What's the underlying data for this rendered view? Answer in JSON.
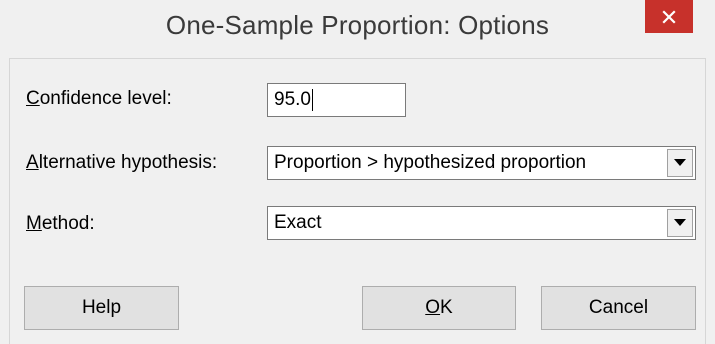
{
  "window": {
    "title": "One-Sample Proportion: Options",
    "close_symbol": "✕"
  },
  "fields": {
    "confidence_level": {
      "label_mnemonic": "C",
      "label_rest": "onfidence level:",
      "value": "95.0"
    },
    "alternative_hypothesis": {
      "label_mnemonic": "A",
      "label_rest": "lternative hypothesis:",
      "selected": "Proportion > hypothesized proportion"
    },
    "method": {
      "label_mnemonic": "M",
      "label_rest": "ethod:",
      "selected": "Exact"
    }
  },
  "buttons": {
    "help": "Help",
    "ok_mnemonic": "O",
    "ok_rest": "K",
    "cancel": "Cancel"
  },
  "icons": {
    "close": "close-icon",
    "dropdown": "dropdown-arrow-icon"
  },
  "colors": {
    "close_button": "#c7312b",
    "background": "#f0f0f0"
  }
}
